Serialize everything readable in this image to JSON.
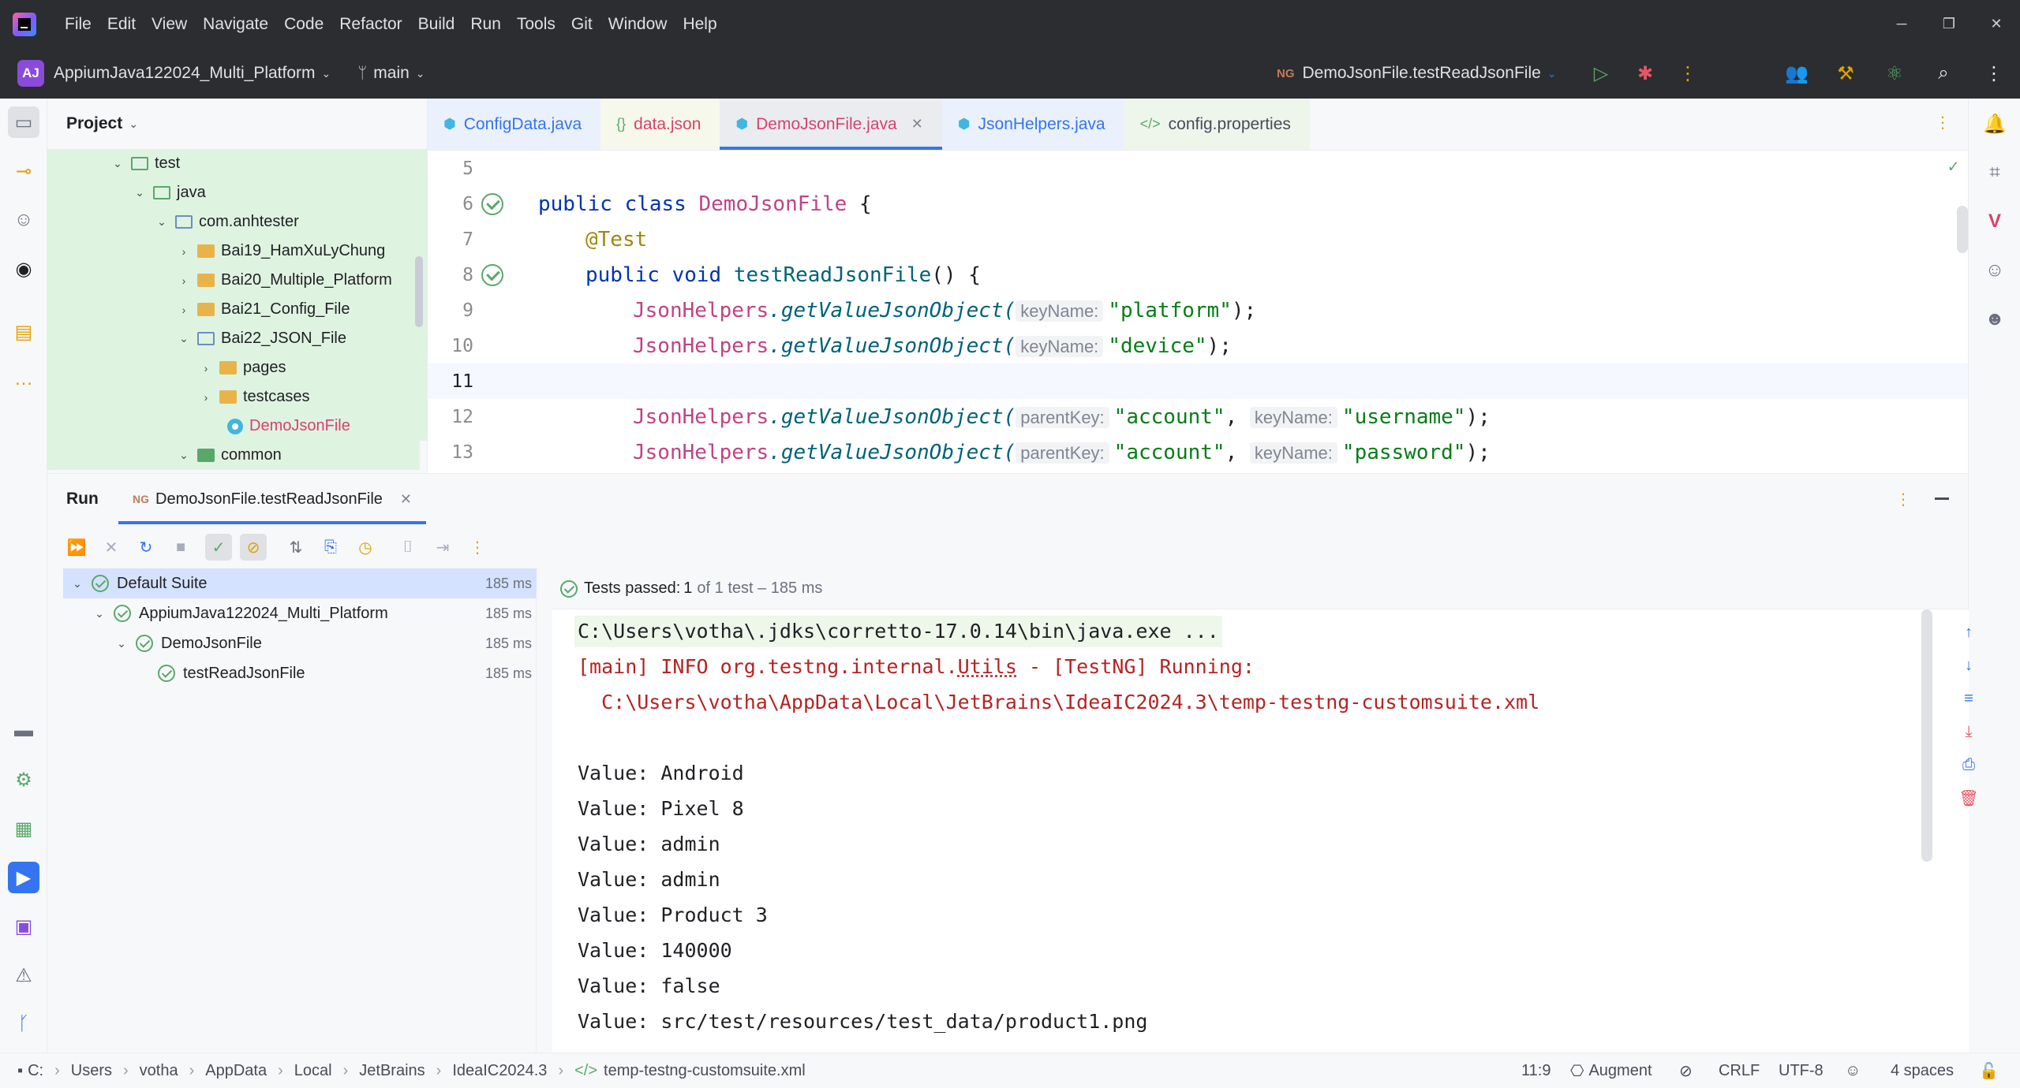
{
  "menubar": {
    "items": [
      "File",
      "Edit",
      "View",
      "Navigate",
      "Code",
      "Refactor",
      "Build",
      "Run",
      "Tools",
      "Git",
      "Window",
      "Help"
    ]
  },
  "toolbar": {
    "project_badge": "AJ",
    "project_name": "AppiumJava122024_Multi_Platform",
    "branch": "main",
    "run_config": "DemoJsonFile.testReadJsonFile",
    "run_config_badge": "NG"
  },
  "project_panel": {
    "title": "Project",
    "tree": [
      {
        "label": "test",
        "expanded": true
      },
      {
        "label": "java",
        "expanded": true
      },
      {
        "label": "com.anhtester",
        "expanded": true
      },
      {
        "label": "Bai19_HamXuLyChung",
        "expanded": false
      },
      {
        "label": "Bai20_Multiple_Platform",
        "expanded": false
      },
      {
        "label": "Bai21_Config_File",
        "expanded": false
      },
      {
        "label": "Bai22_JSON_File",
        "expanded": true
      },
      {
        "label": "pages",
        "expanded": false
      },
      {
        "label": "testcases",
        "expanded": false
      },
      {
        "label": "DemoJsonFile"
      },
      {
        "label": "common",
        "expanded": true
      }
    ]
  },
  "editor": {
    "tabs": [
      {
        "label": "ConfigData.java",
        "icon": "java-class-icon",
        "active": false
      },
      {
        "label": "data.json",
        "icon": "json-icon",
        "active": false
      },
      {
        "label": "DemoJsonFile.java",
        "icon": "java-class-icon",
        "active": true
      },
      {
        "label": "JsonHelpers.java",
        "icon": "java-class-icon",
        "active": false
      },
      {
        "label": "config.properties",
        "icon": "properties-icon",
        "active": false
      }
    ],
    "lines": [
      {
        "num": "5"
      },
      {
        "num": "6",
        "kw": "public class ",
        "cls": "DemoJsonFile",
        "rest": " {"
      },
      {
        "num": "7",
        "ann": "@Test"
      },
      {
        "num": "8",
        "kw": "public void ",
        "fn": "testReadJsonFile",
        "rest": "() {"
      },
      {
        "num": "9",
        "cls": "JsonHelpers",
        "method": ".getValueJsonObject(",
        "hint1": "keyName:",
        "str1": "\"platform\"",
        "end": ");"
      },
      {
        "num": "10",
        "cls": "JsonHelpers",
        "method": ".getValueJsonObject(",
        "hint1": "keyName:",
        "str1": "\"device\"",
        "end": ");"
      },
      {
        "num": "11"
      },
      {
        "num": "12",
        "cls": "JsonHelpers",
        "method": ".getValueJsonObject(",
        "hint1": "parentKey:",
        "str1": "\"account\"",
        "sep": ", ",
        "hint2": "keyName:",
        "str2": "\"username\"",
        "end": ");"
      },
      {
        "num": "13",
        "cls": "JsonHelpers",
        "method": ".getValueJsonObject(",
        "hint1": "parentKey:",
        "str1": "\"account\"",
        "sep": ", ",
        "hint2": "keyName:",
        "str2": "\"password\"",
        "end": ");"
      }
    ]
  },
  "run_panel": {
    "title": "Run",
    "tab_label": "DemoJsonFile.testReadJsonFile",
    "tab_badge": "NG",
    "tests": [
      {
        "label": "Default Suite",
        "time": "185 ms"
      },
      {
        "label": "AppiumJava122024_Multi_Platform",
        "time": "185 ms"
      },
      {
        "label": "DemoJsonFile",
        "time": "185 ms"
      },
      {
        "label": "testReadJsonFile",
        "time": "185 ms"
      }
    ],
    "status_prefix": "Tests passed: ",
    "status_count": "1",
    "status_suffix": "of 1 test – 185 ms",
    "console": {
      "cmd": "C:\\Users\\votha\\.jdks\\corretto-17.0.14\\bin\\java.exe ...",
      "info_prefix": "[main] INFO org.testng.internal.",
      "info_utils": "Utils",
      "info_suffix": " - [TestNG] Running:",
      "info_path": "  C:\\Users\\votha\\AppData\\Local\\JetBrains\\IdeaIC2024.3\\temp-testng-customsuite.xml",
      "values": [
        "Value: Android",
        "Value: Pixel 8",
        "Value: admin",
        "Value: admin",
        "Value: Product 3",
        "Value: 140000",
        "Value: false",
        "Value: src/test/resources/test_data/product1.png"
      ]
    }
  },
  "statusbar": {
    "breadcrumbs": [
      "C:",
      "Users",
      "votha",
      "AppData",
      "Local",
      "JetBrains",
      "IdeaIC2024.3",
      "temp-testng-customsuite.xml"
    ],
    "position": "11:9",
    "augment": "Augment",
    "line_sep": "CRLF",
    "encoding": "UTF-8",
    "indent": "4 spaces"
  }
}
